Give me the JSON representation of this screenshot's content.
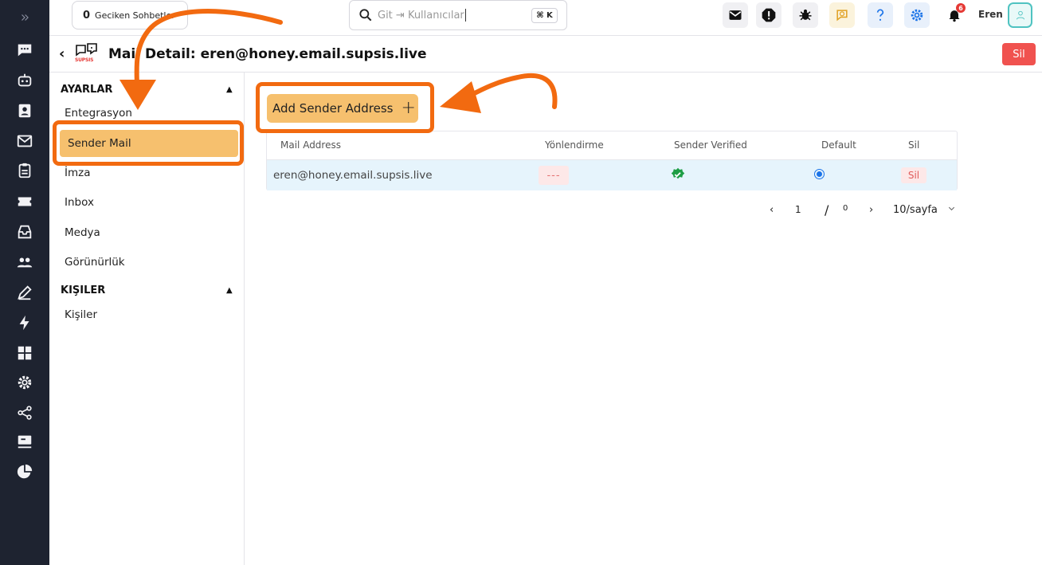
{
  "topbar": {
    "late_chats_count": "0",
    "late_chats_label": "Geciken Sohbetler",
    "search_placeholder": "Git ⇥ Kullanıcılar",
    "search_shortcut": "⌘ K",
    "notification_count": "6",
    "username": "Eren"
  },
  "header": {
    "back": "‹",
    "logo_text": "SUPSIS",
    "title": "Mail Detail: eren@honey.email.supsis.live",
    "delete_label": "Sil"
  },
  "sidebar": {
    "sections": [
      {
        "title": "AYARLAR",
        "items": [
          "Entegrasyon",
          "Sender Mail",
          "İmza",
          "Inbox",
          "Medya",
          "Görünürlük"
        ]
      },
      {
        "title": "KIŞILER",
        "items": [
          "Kişiler"
        ]
      }
    ],
    "active_item": "Sender Mail"
  },
  "main": {
    "add_button_label": "Add Sender Address",
    "add_button_icon": "plus-icon",
    "table": {
      "columns": [
        "Mail Address",
        "Yönlendirme",
        "Sender Verified",
        "Default",
        "Sil"
      ],
      "rows": [
        {
          "mail": "eren@honey.email.supsis.live",
          "redirect": "---",
          "verified": "check-circle-icon",
          "default": "radio-selected",
          "delete": "Sil"
        }
      ]
    },
    "pagination": {
      "prev": "‹",
      "current_page": "1",
      "separator": "/",
      "total_pages": "0",
      "next": "›",
      "page_size": "10/sayfa",
      "page_size_icon": "chevron-down-icon"
    }
  },
  "colors": {
    "rail_bg": "#1e2330",
    "accent": "#f6c06e",
    "annotation": "#f26a10",
    "danger": "#f0524f"
  }
}
